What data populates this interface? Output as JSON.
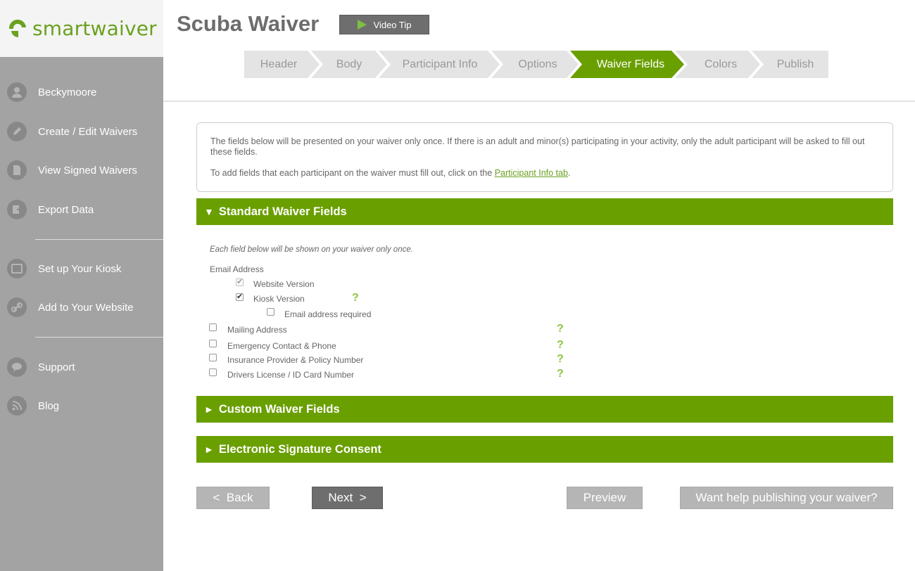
{
  "brand": {
    "name": "smartwaiver",
    "accent": "#6a9f00",
    "logo_green": "#6aa120"
  },
  "sidebar": {
    "items": [
      {
        "label": "Beckymoore",
        "icon": "user-icon"
      },
      {
        "label": "Create / Edit Waivers",
        "icon": "pencil-icon"
      },
      {
        "label": "View Signed Waivers",
        "icon": "document-icon"
      },
      {
        "label": "Export Data",
        "icon": "export-icon"
      },
      {
        "label": "Set up Your Kiosk",
        "icon": "tablet-icon"
      },
      {
        "label": "Add to Your Website",
        "icon": "link-icon"
      },
      {
        "label": "Support",
        "icon": "chat-icon"
      },
      {
        "label": "Blog",
        "icon": "rss-icon"
      }
    ]
  },
  "header": {
    "title": "Scuba Waiver",
    "video_tip": "Video Tip"
  },
  "steps": [
    {
      "label": "Header",
      "active": false
    },
    {
      "label": "Body",
      "active": false
    },
    {
      "label": "Participant Info",
      "active": false
    },
    {
      "label": "Options",
      "active": false
    },
    {
      "label": "Waiver Fields",
      "active": true
    },
    {
      "label": "Colors",
      "active": false
    },
    {
      "label": "Publish",
      "active": false
    }
  ],
  "info": {
    "line1": "The fields below will be presented on your waiver only once. If there is an adult and minor(s) participating in your activity, only the adult participant will be asked to fill out these fields.",
    "line2_prefix": "To add fields that each participant on the waiver must fill out, click on the ",
    "line2_link": "Participant Info tab",
    "line2_suffix": "."
  },
  "sections": {
    "standard": {
      "label": "Standard Waiver Fields",
      "arrow": "▼",
      "expanded": true
    },
    "custom": {
      "label": "Custom Waiver Fields",
      "arrow": "►",
      "expanded": false
    },
    "signature": {
      "label": "Electronic Signature Consent",
      "arrow": "►",
      "expanded": false
    }
  },
  "standard_fields": {
    "note": "Each field below will be shown on your waiver only once.",
    "email_label": "Email Address",
    "website_version": {
      "label": "Website Version",
      "checked": true,
      "disabled": true
    },
    "kiosk_version": {
      "label": "Kiosk Version",
      "checked": true
    },
    "email_required": {
      "label": "Email address required",
      "checked": false
    },
    "mailing": {
      "label": "Mailing Address",
      "checked": false
    },
    "emergency": {
      "label": "Emergency Contact & Phone",
      "checked": false
    },
    "insurance": {
      "label": "Insurance Provider & Policy Number",
      "checked": false
    },
    "license": {
      "label": "Drivers License / ID Card Number",
      "checked": false
    },
    "help_glyph": "?"
  },
  "buttons": {
    "back": "<  Back",
    "next": "Next  >",
    "preview": "Preview",
    "help_publish": "Want help publishing your waiver?"
  }
}
